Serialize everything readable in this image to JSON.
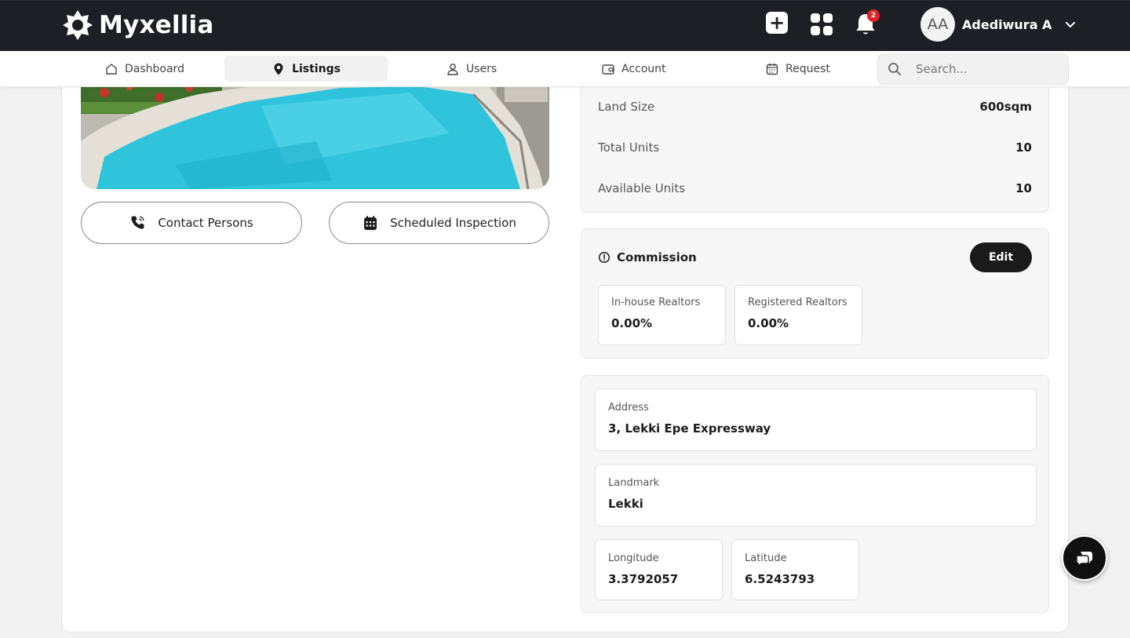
{
  "app": {
    "name": "Myxellia"
  },
  "header": {
    "notification_count": "2",
    "user_initials": "AA",
    "user_name": "Adediwura A"
  },
  "nav": {
    "items": [
      {
        "label": "Dashboard",
        "icon": "home-icon"
      },
      {
        "label": "Listings",
        "icon": "map-pin-icon",
        "active": true
      },
      {
        "label": "Users",
        "icon": "user-icon"
      },
      {
        "label": "Account",
        "icon": "wallet-icon"
      },
      {
        "label": "Request",
        "icon": "calendar-icon"
      }
    ],
    "search_placeholder": "Search..."
  },
  "listing": {
    "actions": {
      "contact_label": "Contact Persons",
      "inspection_label": "Scheduled Inspection"
    },
    "details": [
      {
        "key": "Land Size",
        "value": "600sqm"
      },
      {
        "key": "Total Units",
        "value": "10"
      },
      {
        "key": "Available Units",
        "value": "10"
      }
    ],
    "commission": {
      "title": "Commission",
      "edit_label": "Edit",
      "items": [
        {
          "label": "In-house Realtors",
          "value": "0.00%"
        },
        {
          "label": "Registered Realtors",
          "value": "0.00%"
        }
      ]
    },
    "location": {
      "address_label": "Address",
      "address_value": "3, Lekki Epe Expressway",
      "landmark_label": "Landmark",
      "landmark_value": "Lekki",
      "longitude_label": "Longitude",
      "longitude_value": "3.3792057",
      "latitude_label": "Latitude",
      "latitude_value": "6.5243793"
    }
  },
  "colors": {
    "topbar": "#1d1f24",
    "accent_dark": "#1a1a1a",
    "badge": "#e32424"
  }
}
